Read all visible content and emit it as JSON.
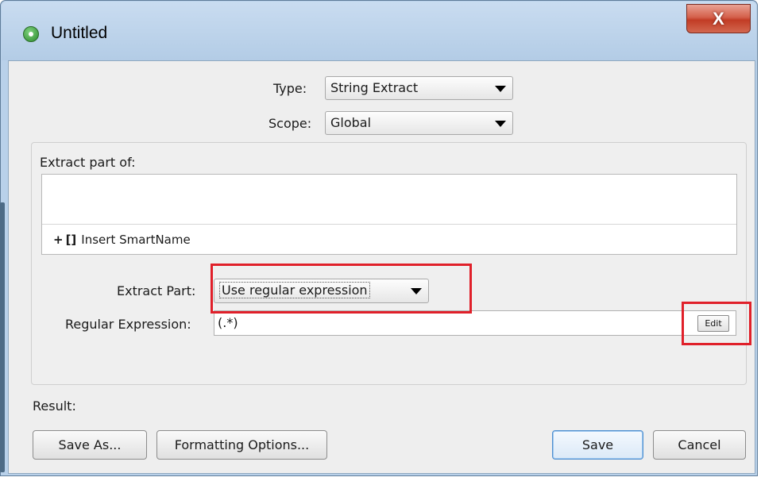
{
  "window": {
    "title": "Untitled",
    "close_glyph": "X"
  },
  "type_row": {
    "label": "Type:",
    "value": "String Extract"
  },
  "scope_row": {
    "label": "Scope:",
    "value": "Global"
  },
  "extract_group": {
    "label": "Extract part of:",
    "insert_plus": "+",
    "insert_brackets": "[]",
    "insert_label": "Insert SmartName"
  },
  "extract_part": {
    "label": "Extract Part:",
    "value": "Use regular expression"
  },
  "regex": {
    "label": "Regular Expression:",
    "value": "(.*)",
    "edit_label": "Edit"
  },
  "result": {
    "label": "Result:"
  },
  "footer": {
    "save_as_label": "Save As...",
    "formatting_label": "Formatting Options...",
    "save_label": "Save",
    "cancel_label": "Cancel"
  },
  "icons": {
    "app": "app-gear-icon",
    "close": "close-icon",
    "dropdown": "chevron-down-icon",
    "plus": "plus-icon"
  },
  "colors": {
    "highlight": "#e0202a",
    "titlebar": "#b9d1ea",
    "close_button": "#c23c25"
  }
}
